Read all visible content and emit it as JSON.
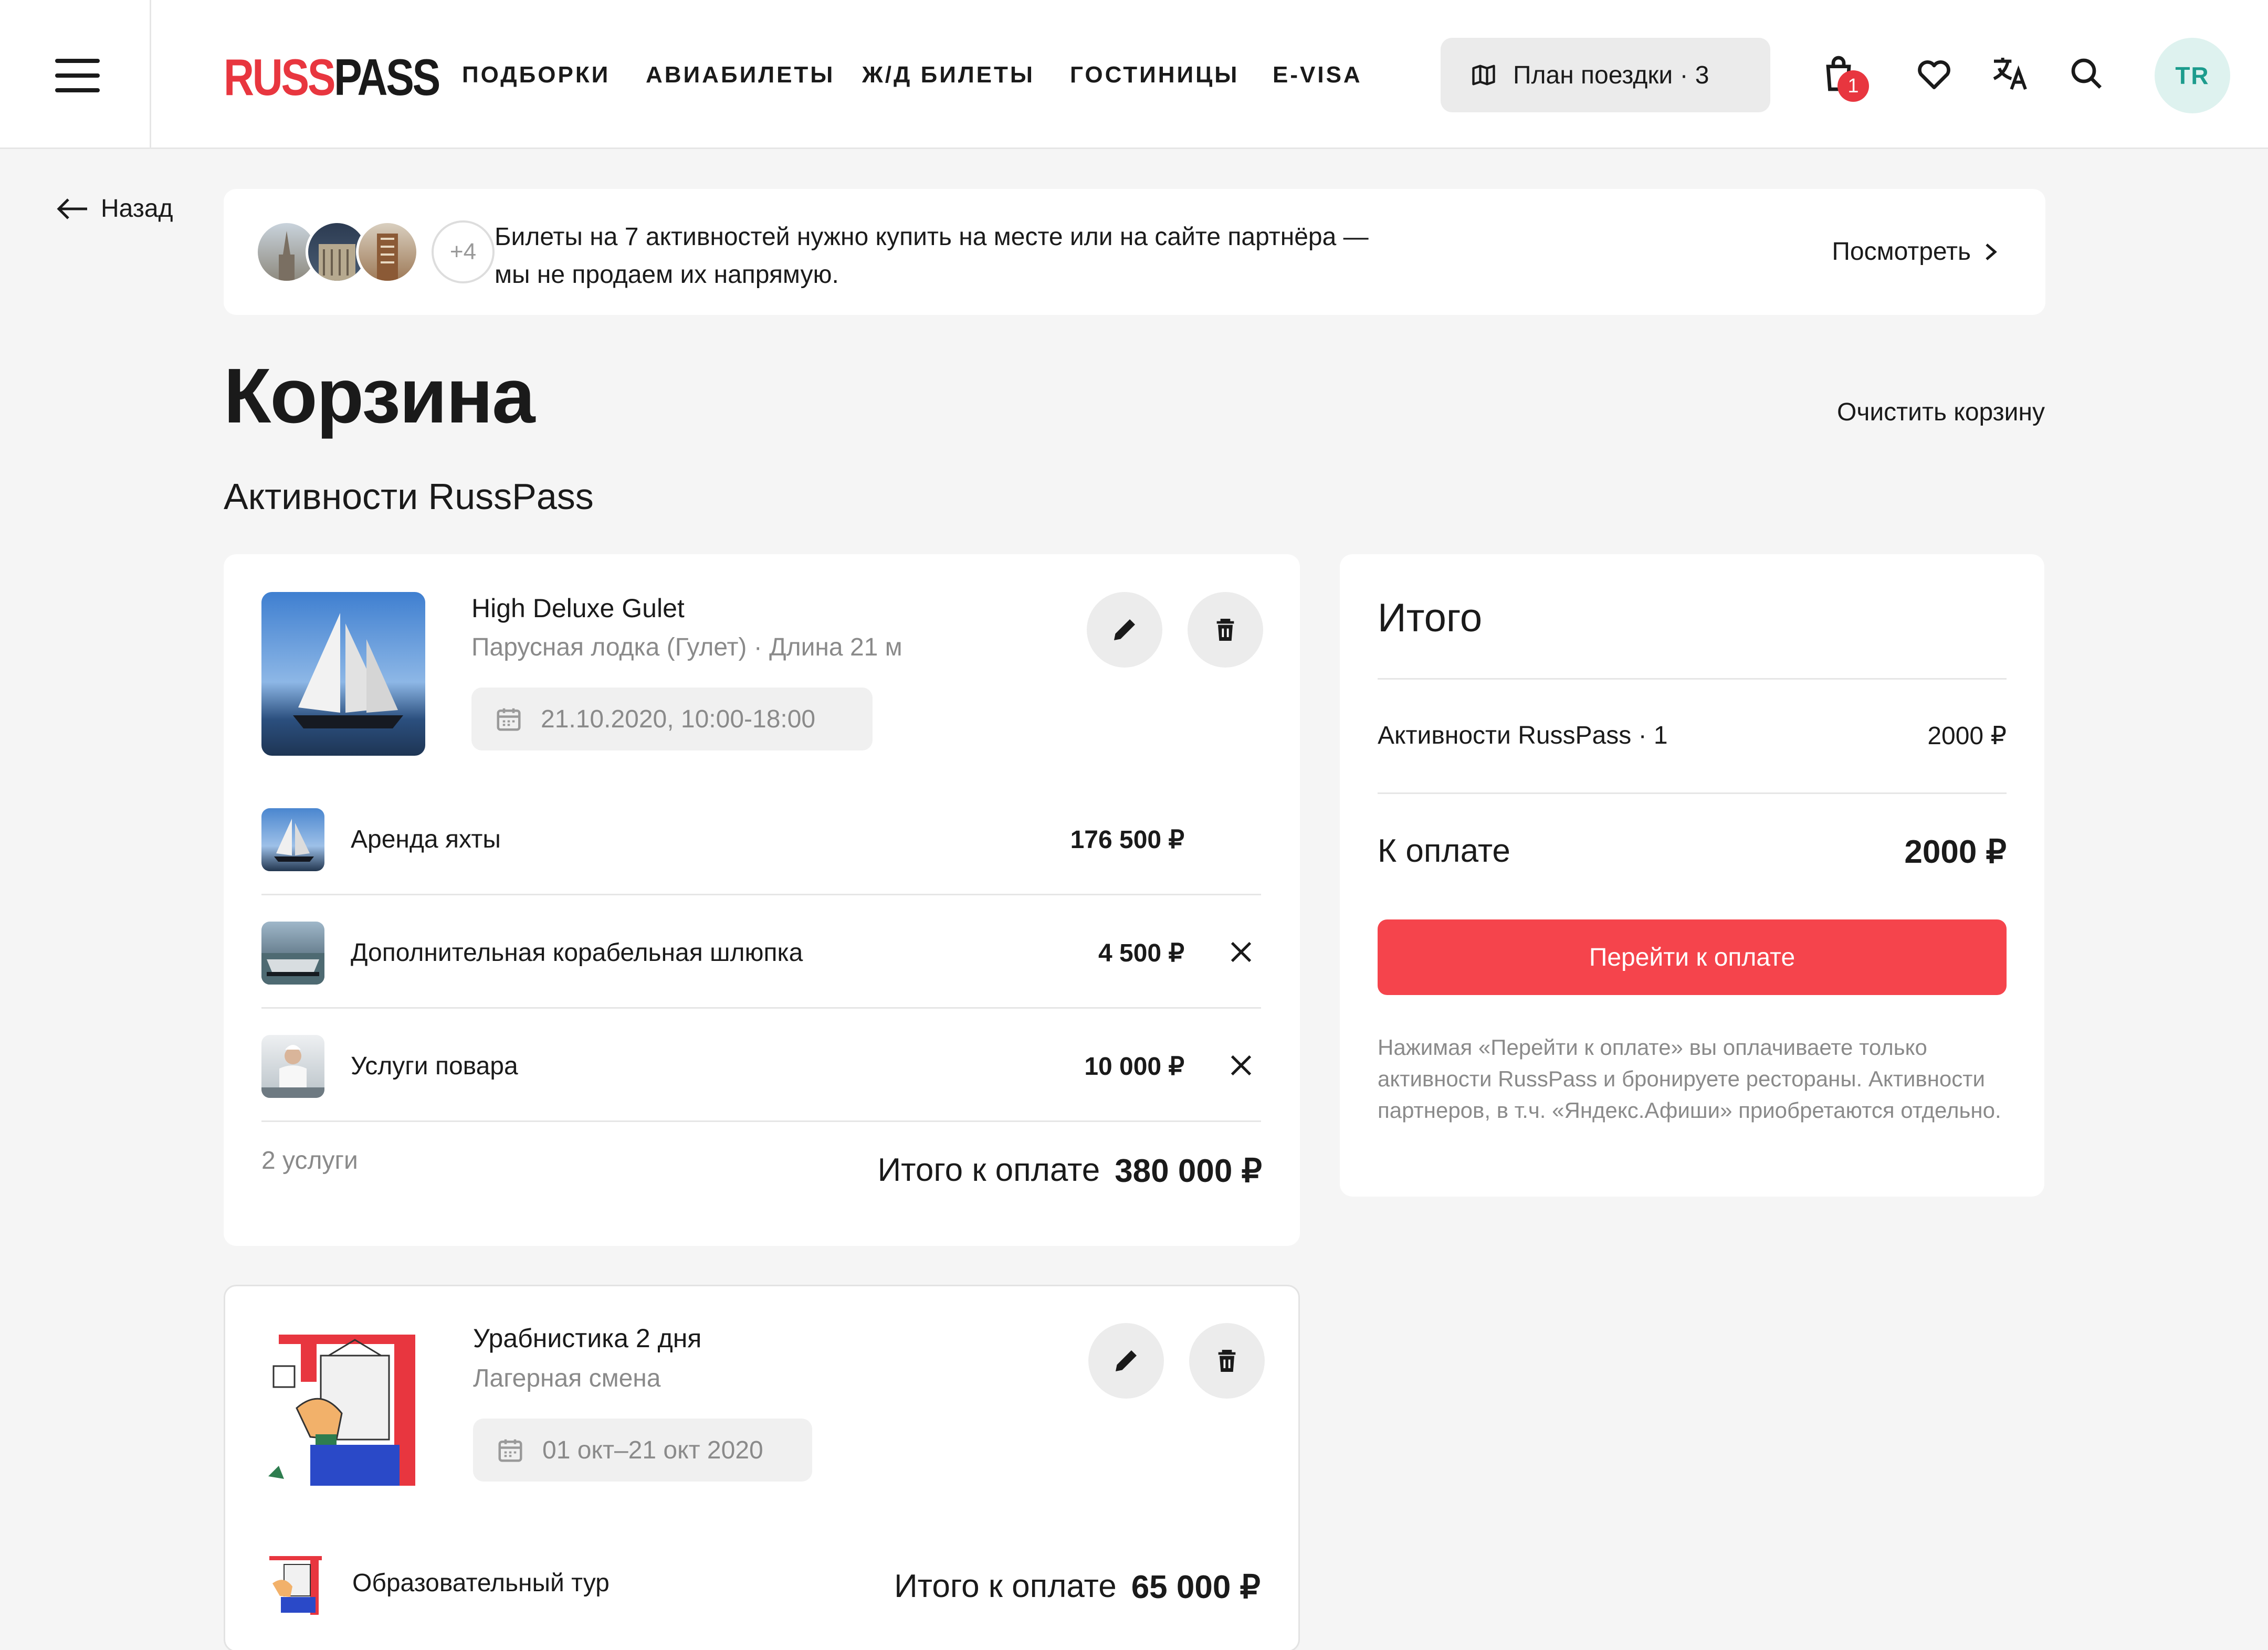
{
  "header": {
    "logo_left": "RUSS",
    "logo_right": "PASS",
    "nav": [
      "ПОДБОРКИ",
      "АВИАБИЛЕТЫ",
      "Ж/Д БИЛЕТЫ",
      "ГОСТИНИЦЫ",
      "E-VISA"
    ],
    "plan_label": "План поездки · 3",
    "cart_badge": "1",
    "avatar_initials": "TR"
  },
  "back_label": "Назад",
  "notice": {
    "more_count": "+4",
    "text_line1": "Билеты на 7 активностей нужно купить на месте или на сайте партнёра —",
    "text_line2": "мы не продаем их напрямую.",
    "link": "Посмотреть"
  },
  "page_title": "Корзина",
  "clear_cart": "Очистить корзину",
  "section_title": "Активности RussPass",
  "activity1": {
    "title": "High Deluxe Gulet",
    "subtitle": "Парусная лодка (Гулет) · Длина 21 м",
    "date": "21.10.2020, 10:00-18:00",
    "services": [
      {
        "name": "Аренда яхты",
        "price": "176 500 ₽"
      },
      {
        "name": "Дополнительная корабельная шлюпка",
        "price": "4 500 ₽"
      },
      {
        "name": "Услуги повара",
        "price": "10 000 ₽"
      }
    ],
    "count": "2 услуги",
    "total_label": "Итого к оплате",
    "total_value": "380 000 ₽"
  },
  "activity2": {
    "title": "Урабнистика 2 дня",
    "subtitle": "Лагерная смена",
    "date": "01 окт–21 окт 2020",
    "service_name": "Образовательный тур",
    "total_label": "Итого к оплате",
    "total_value": "65 000 ₽"
  },
  "summary": {
    "title": "Итого",
    "row_label": "Активности RussPass · 1",
    "row_value": "2000 ₽",
    "pay_label": "К оплате",
    "pay_value": "2000 ₽",
    "button": "Перейти к оплате",
    "note": "Нажимая «Перейти к оплате» вы оплачиваете только активности RussPass и бронируете рестораны. Активности партнеров, в т.ч. «Яндекс.Афиши» приобретаются отдельно."
  },
  "colors": {
    "brand_red": "#e8363f",
    "button_red": "#f5444c",
    "avatar_bg": "#def2ef",
    "avatar_text": "#1c9c8d"
  }
}
